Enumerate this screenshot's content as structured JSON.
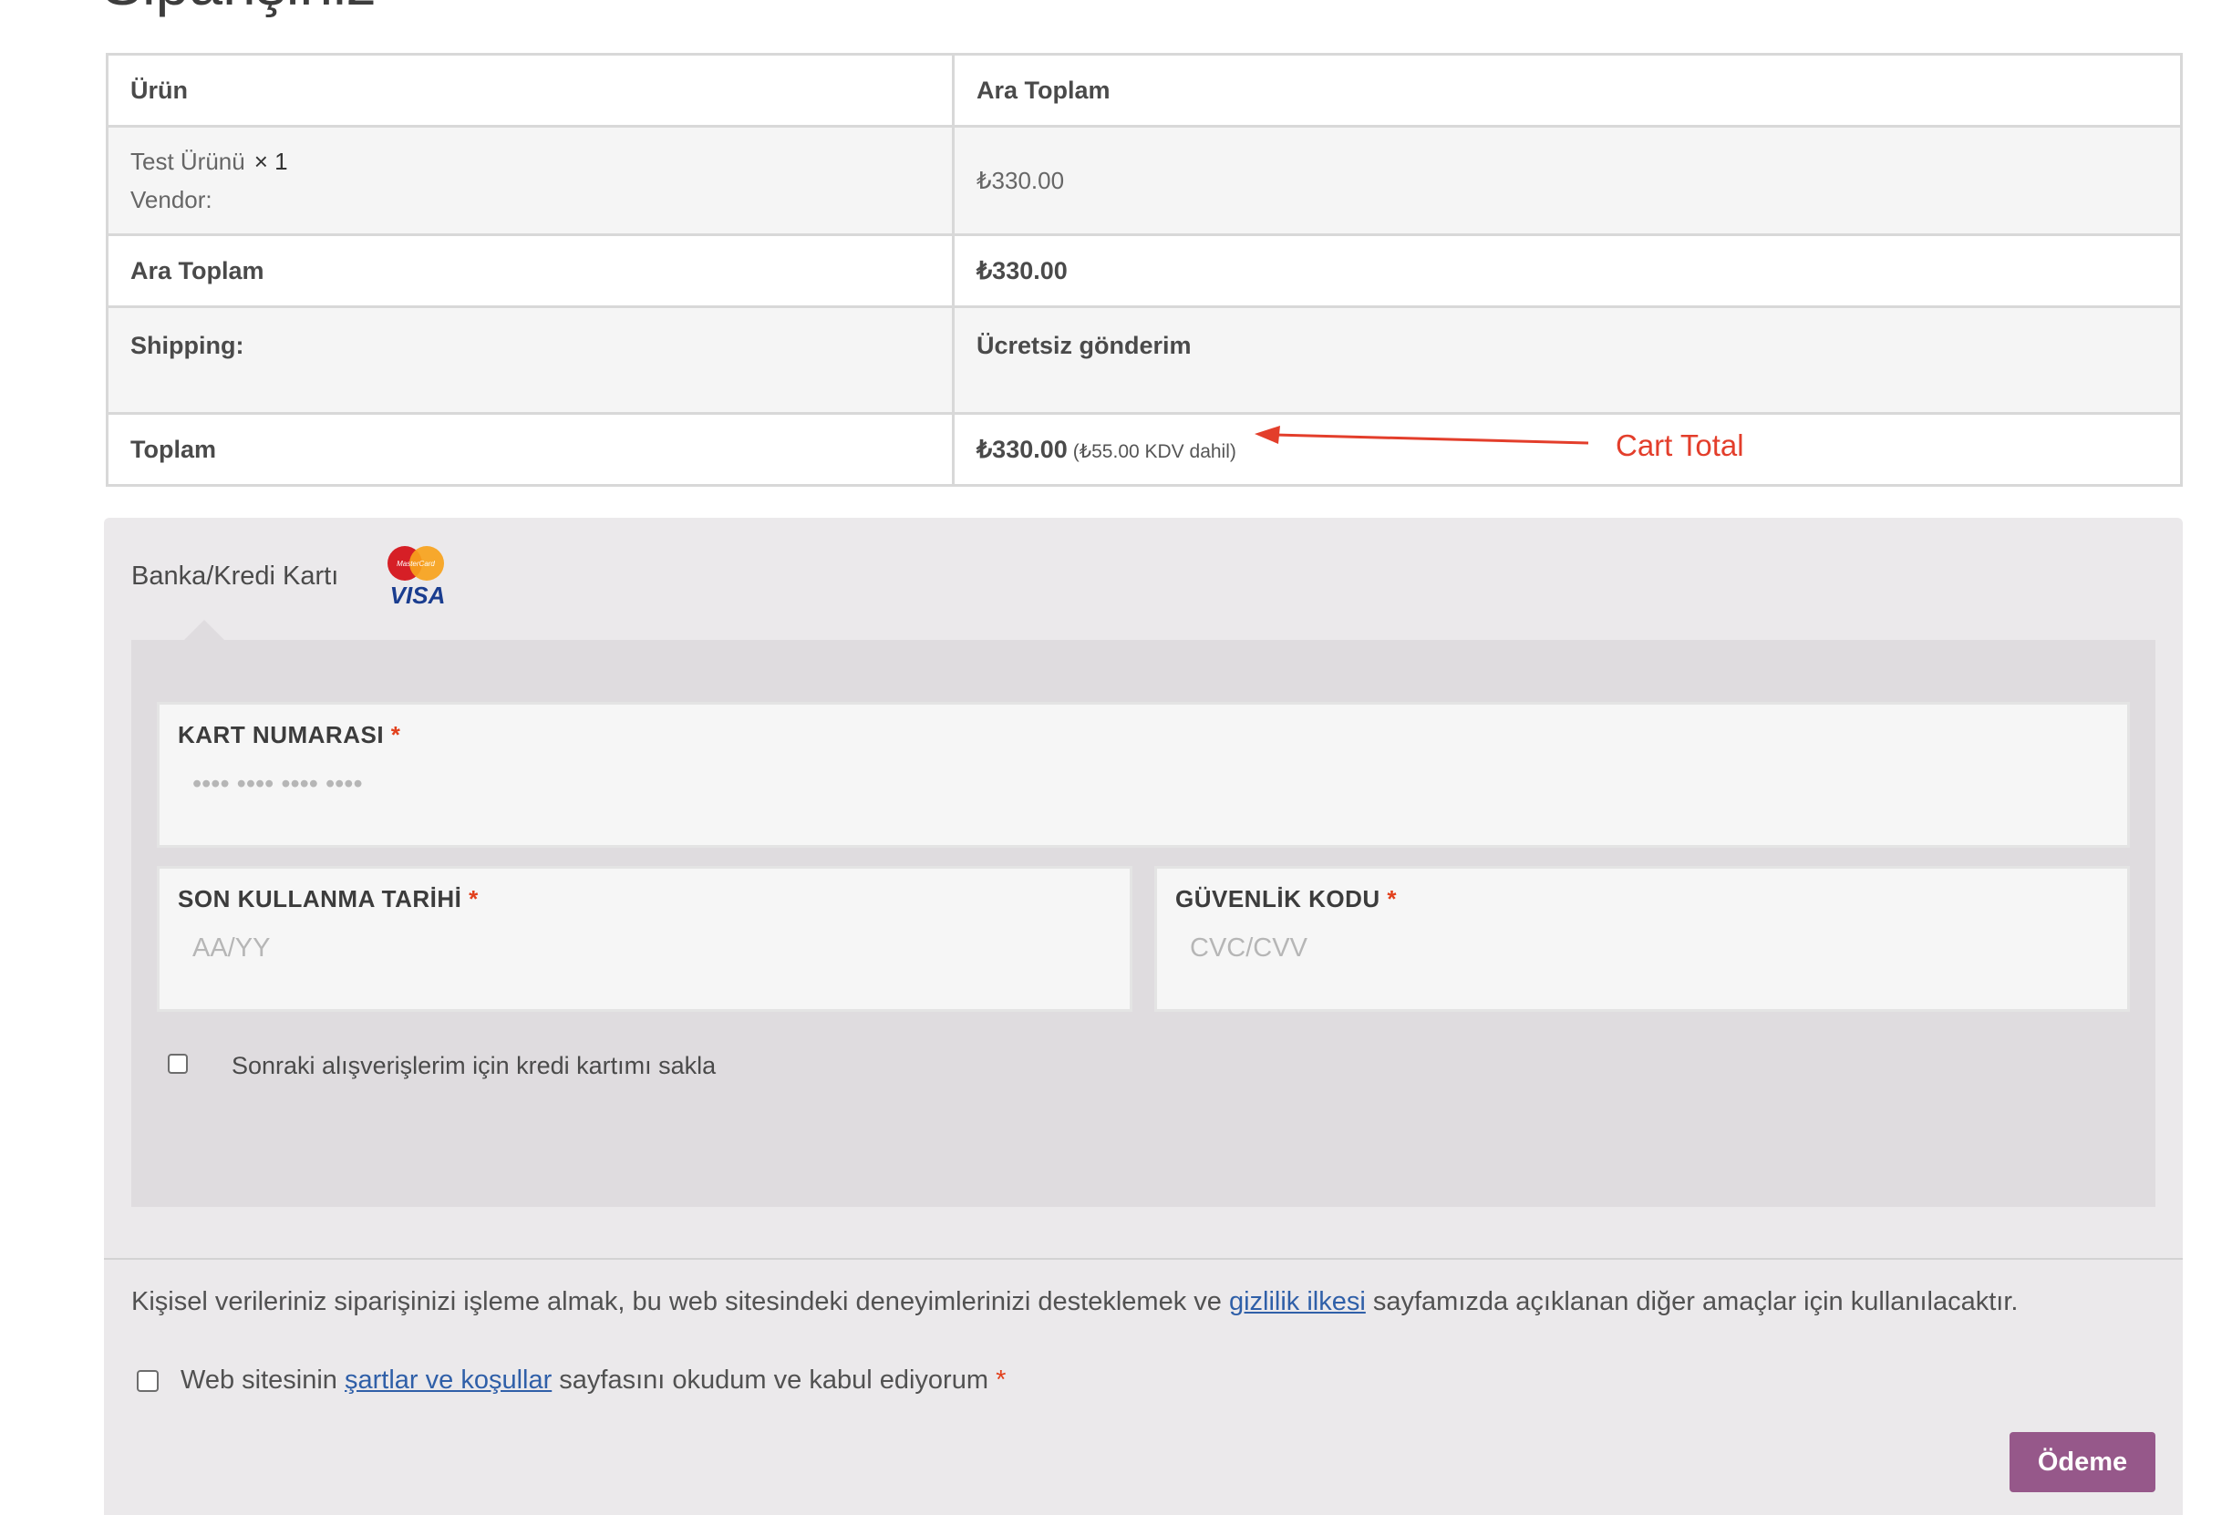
{
  "page": {
    "heading": "Siparişiniz"
  },
  "order_table": {
    "header": {
      "product": "Ürün",
      "subtotal": "Ara Toplam"
    },
    "item": {
      "name": "Test Ürünü",
      "quantity": "× 1",
      "vendor": "Vendor:",
      "price": "₺330.00"
    },
    "subtotal_row": {
      "label": "Ara Toplam",
      "value": "₺330.00"
    },
    "shipping_row": {
      "label": "Shipping:",
      "value": "Ücretsiz gönderim"
    },
    "total_row": {
      "label": "Toplam",
      "value": "₺330.00",
      "tax_note": "(₺55.00 KDV dahil)"
    }
  },
  "annotation": {
    "label": "Cart Total",
    "color": "#e33e2b"
  },
  "payment": {
    "method_label": "Banka/Kredi Kartı",
    "card_logo_text": {
      "top": "MasterCard",
      "bottom": "VISA"
    },
    "card_number": {
      "label": "KART NUMARASI",
      "required": "*",
      "placeholder": "•••• •••• •••• ••••"
    },
    "expiry": {
      "label": "SON KULLANMA TARİHİ",
      "required": "*",
      "placeholder": "AA/YY"
    },
    "cvc": {
      "label": "GÜVENLİK KODU",
      "required": "*",
      "placeholder": "CVC/CVV"
    },
    "save_card_label": "Sonraki alışverişlerim için kredi kartımı sakla"
  },
  "privacy": {
    "before": "Kişisel verileriniz siparişinizi işleme almak, bu web sitesindeki deneyimlerinizi desteklemek ve ",
    "link": "gizlilik ilkesi",
    "after": " sayfamızda açıklanan diğer amaçlar için kullanılacaktır."
  },
  "terms": {
    "before": "Web sitesinin ",
    "link": "şartlar ve koşullar",
    "after": " sayfasını okudum ve kabul ediyorum",
    "required": "*"
  },
  "pay_button": {
    "label": "Ödeme",
    "color": "#96588a"
  }
}
